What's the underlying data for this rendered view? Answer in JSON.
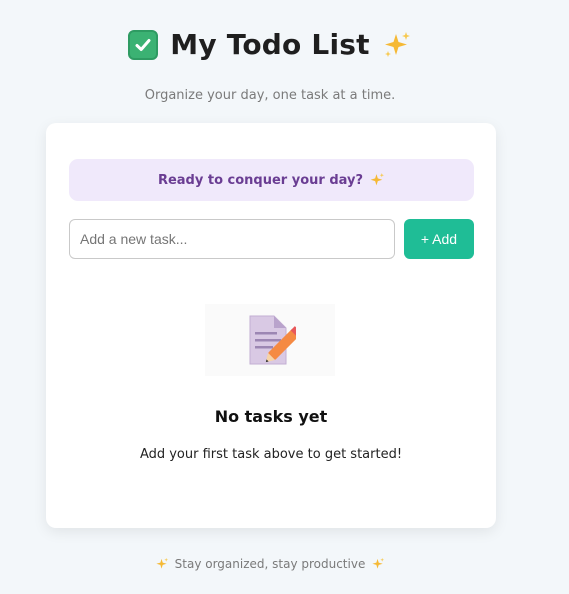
{
  "header": {
    "title": "My Todo List",
    "title_icon": "check-mark-button-icon",
    "title_trailing_icon": "sparkles-icon",
    "subtitle": "Organize your day, one task at a time."
  },
  "card": {
    "banner_text": "Ready to conquer your day?",
    "banner_icon": "sparkles-icon",
    "input": {
      "placeholder": "Add a new task...",
      "value": ""
    },
    "add_button_label": "+ Add",
    "empty_state": {
      "icon": "memo-icon",
      "title": "No tasks yet",
      "description": "Add your first task above to get started!"
    }
  },
  "footer": {
    "text": "Stay organized, stay productive"
  },
  "colors": {
    "background": "#f3f7fa",
    "accent": "#1fbd96",
    "banner_bg": "#f0e9fb",
    "banner_text": "#6a3d93",
    "check_green": "#3bb273"
  }
}
